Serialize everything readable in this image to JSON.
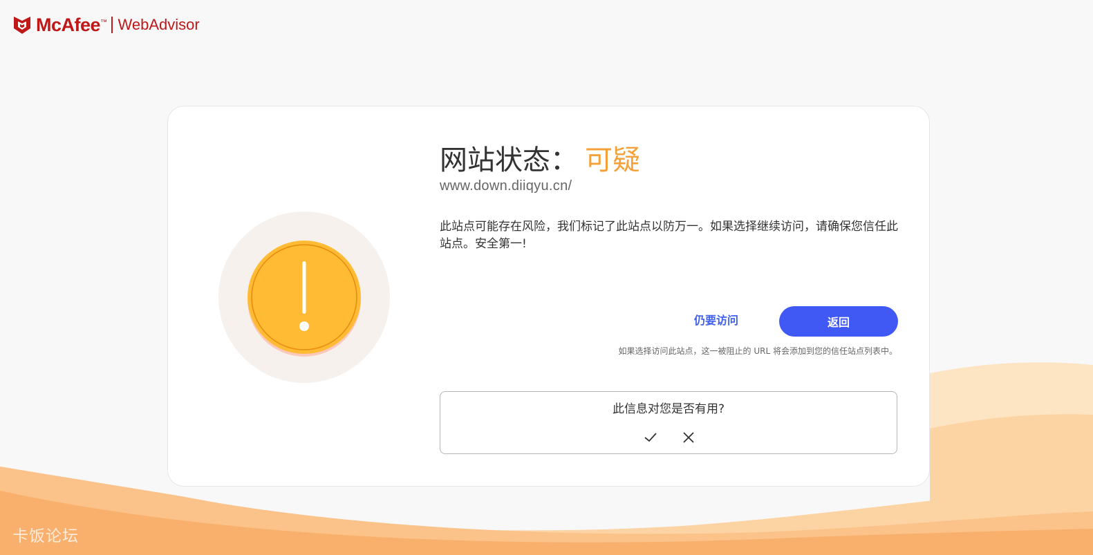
{
  "header": {
    "brand": "McAfee",
    "trademark": "™",
    "product": "WebAdvisor"
  },
  "colors": {
    "brand_red": "#c01818",
    "accent_blue": "#4059f5",
    "status_orange": "#f5a13a",
    "warning_yellow": "#ffbb33"
  },
  "status": {
    "label": "网站状态：",
    "value": "可疑"
  },
  "site": {
    "url": "www.down.diiqyu.cn/"
  },
  "message": "此站点可能存在风险，我们标记了此站点以防万一。如果选择继续访问，请确保您信任此站点。安全第一!",
  "actions": {
    "visit_anyway": "仍要访问",
    "back": "返回",
    "trust_note": "如果选择访问此站点，这一被阻止的 URL 将会添加到您的信任站点列表中。"
  },
  "feedback": {
    "question": "此信息对您是否有用?",
    "yes_icon": "check-icon",
    "no_icon": "close-icon"
  },
  "warning_icon": "exclamation-icon",
  "watermark": "卡饭论坛"
}
